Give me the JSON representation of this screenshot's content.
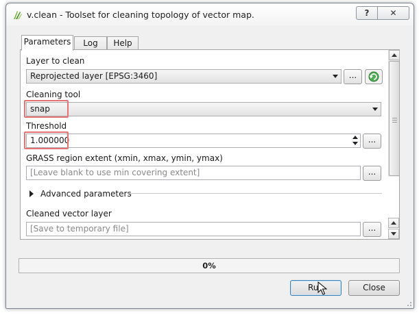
{
  "window": {
    "title": "v.clean - Toolset for cleaning topology of vector map.",
    "help_symbol": "?",
    "close_symbol": "✕"
  },
  "tabs": [
    {
      "label": "Parameters",
      "active": true
    },
    {
      "label": "Log",
      "active": false
    },
    {
      "label": "Help",
      "active": false
    }
  ],
  "params": {
    "layer_label": "Layer to clean",
    "layer_value": "Reprojected layer [EPSG:3460]",
    "tool_label": "Cleaning tool",
    "tool_value": "snap",
    "threshold_label": "Threshold",
    "threshold_value": "1.000000",
    "region_label": "GRASS region extent (xmin, xmax, ymin, ymax)",
    "region_placeholder": "[Leave blank to use min covering extent]",
    "advanced_label": "Advanced parameters",
    "output_label": "Cleaned vector layer",
    "output_placeholder": "[Save to temporary file]",
    "browse_label": "..."
  },
  "progress": {
    "value": 0,
    "text": "0%"
  },
  "buttons": {
    "run": "Run",
    "close": "Close"
  },
  "colors": {
    "highlight": "#e57373",
    "accent": "#3c7fb1",
    "iterate_icon": "#3a9a3a"
  },
  "icons": {
    "app": "qgis-grass-icon",
    "iterate": "iterate-icon",
    "cursor": "mouse-pointer-icon"
  }
}
